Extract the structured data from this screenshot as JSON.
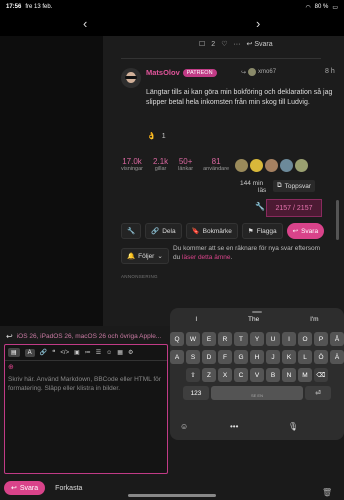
{
  "status_bar": {
    "time": "17:56",
    "date": "fre 13 feb.",
    "battery": "80 %"
  },
  "post": {
    "top_row": {
      "count": "2",
      "reply_label": "Svara"
    },
    "author": "MatsOlov",
    "badge": "PATREON",
    "reply_to": "xmo67",
    "time_ago": "8 h",
    "body": "Längtar tills ai kan göra min bokföring och deklaration så jag slipper betal hela inkomsten från min skog till Ludvig.",
    "likes": "1"
  },
  "stats": [
    {
      "value": "17.0k",
      "label": "visningar"
    },
    {
      "value": "2.1k",
      "label": "gillar"
    },
    {
      "value": "50+",
      "label": "länkar"
    },
    {
      "value": "81",
      "label": "användare"
    }
  ],
  "participants_colors": [
    "#9a8a5a",
    "#d8b83a",
    "#a58060",
    "#6c8a9a",
    "#9aa070"
  ],
  "read_time": {
    "value": "144 min",
    "unit": "läs"
  },
  "toppsvar_label": "Toppsvar",
  "progress_text": "2157 / 2157",
  "actions": {
    "share": "Dela",
    "bookmark": "Bokmärke",
    "flag": "Flagga",
    "reply": "Svara"
  },
  "follow": {
    "label": "Följer",
    "note_prefix": "Du kommer att se en räknare för nya svar eftersom du ",
    "note_link": "läser detta ämne",
    "note_suffix": "."
  },
  "annonsering": "ANNONSERING",
  "composer": {
    "title": "iOS 26, iPadOS 26, macOS 26 och övriga Apple...",
    "toolbar_a": "A",
    "placeholder": "Skriv här. Använd Markdown, BBCode eller HTML för formatering. Släpp eller klistra in bilder.",
    "submit": "Svara",
    "cancel": "Forkasta"
  },
  "keyboard": {
    "suggestions": [
      "I",
      "The",
      "I'm"
    ],
    "row1": [
      "Q",
      "W",
      "E",
      "R",
      "T",
      "Y",
      "U",
      "I",
      "O",
      "P",
      "Å"
    ],
    "row2": [
      "A",
      "S",
      "D",
      "F",
      "G",
      "H",
      "J",
      "K",
      "L",
      "Ö",
      "Ä"
    ],
    "row3": [
      "Z",
      "X",
      "C",
      "V",
      "B",
      "N",
      "M"
    ],
    "numbers_key": "123",
    "space_label": "SE EN",
    "return_key": "⏎"
  }
}
